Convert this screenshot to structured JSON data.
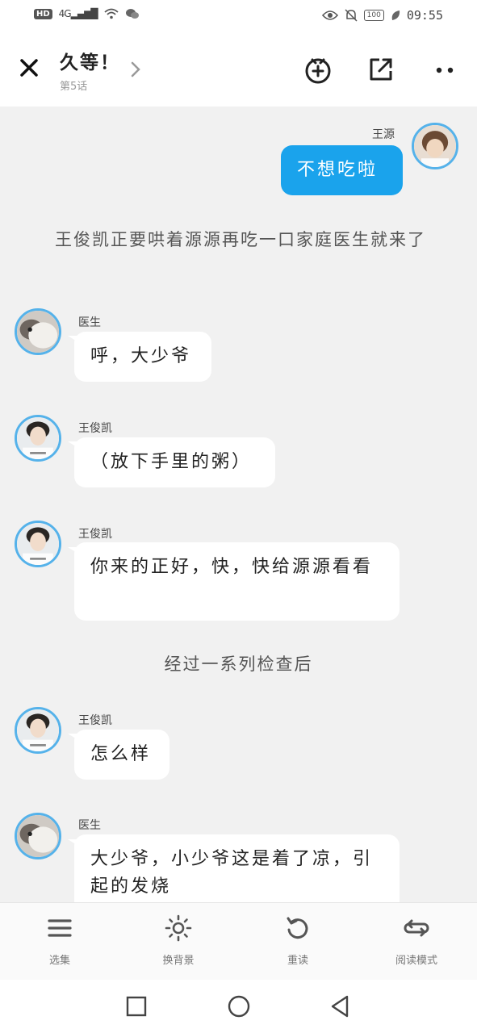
{
  "statusbar": {
    "hd": "HD",
    "signal": "4G",
    "battery": "100",
    "time": "09:55"
  },
  "header": {
    "title": "久等！",
    "subtitle": "第5话",
    "icons": [
      "close-icon",
      "chevron-right-icon",
      "add-favorite-icon",
      "share-icon",
      "more-icon"
    ]
  },
  "chat": {
    "messages": [
      {
        "type": "me",
        "name": "王源",
        "text": "不想吃啦"
      },
      {
        "type": "narration",
        "text": "王俊凯正要哄着源源再吃一口家庭医生就来了"
      },
      {
        "type": "other",
        "name": "医生",
        "text": "呼，大少爷"
      },
      {
        "type": "other",
        "name": "王俊凯",
        "text": "（放下手里的粥）"
      },
      {
        "type": "other",
        "name": "王俊凯",
        "text": "你来的正好，快，快给源源看看"
      },
      {
        "type": "narration",
        "text": "经过一系列检查后"
      },
      {
        "type": "other",
        "name": "王俊凯",
        "text": "怎么样"
      },
      {
        "type": "other",
        "name": "医生",
        "text": "大少爷，小少爷这是着了凉，引起的发烧"
      }
    ]
  },
  "toolbar": {
    "items": [
      {
        "label": "选集",
        "icon": "menu-icon"
      },
      {
        "label": "换背景",
        "icon": "brightness-icon"
      },
      {
        "label": "重读",
        "icon": "replay-icon"
      },
      {
        "label": "阅读模式",
        "icon": "loop-icon"
      }
    ]
  },
  "colors": {
    "accent": "#1aa3ec",
    "avatar_ring": "#55b2ea",
    "background": "#f1f1f1"
  }
}
